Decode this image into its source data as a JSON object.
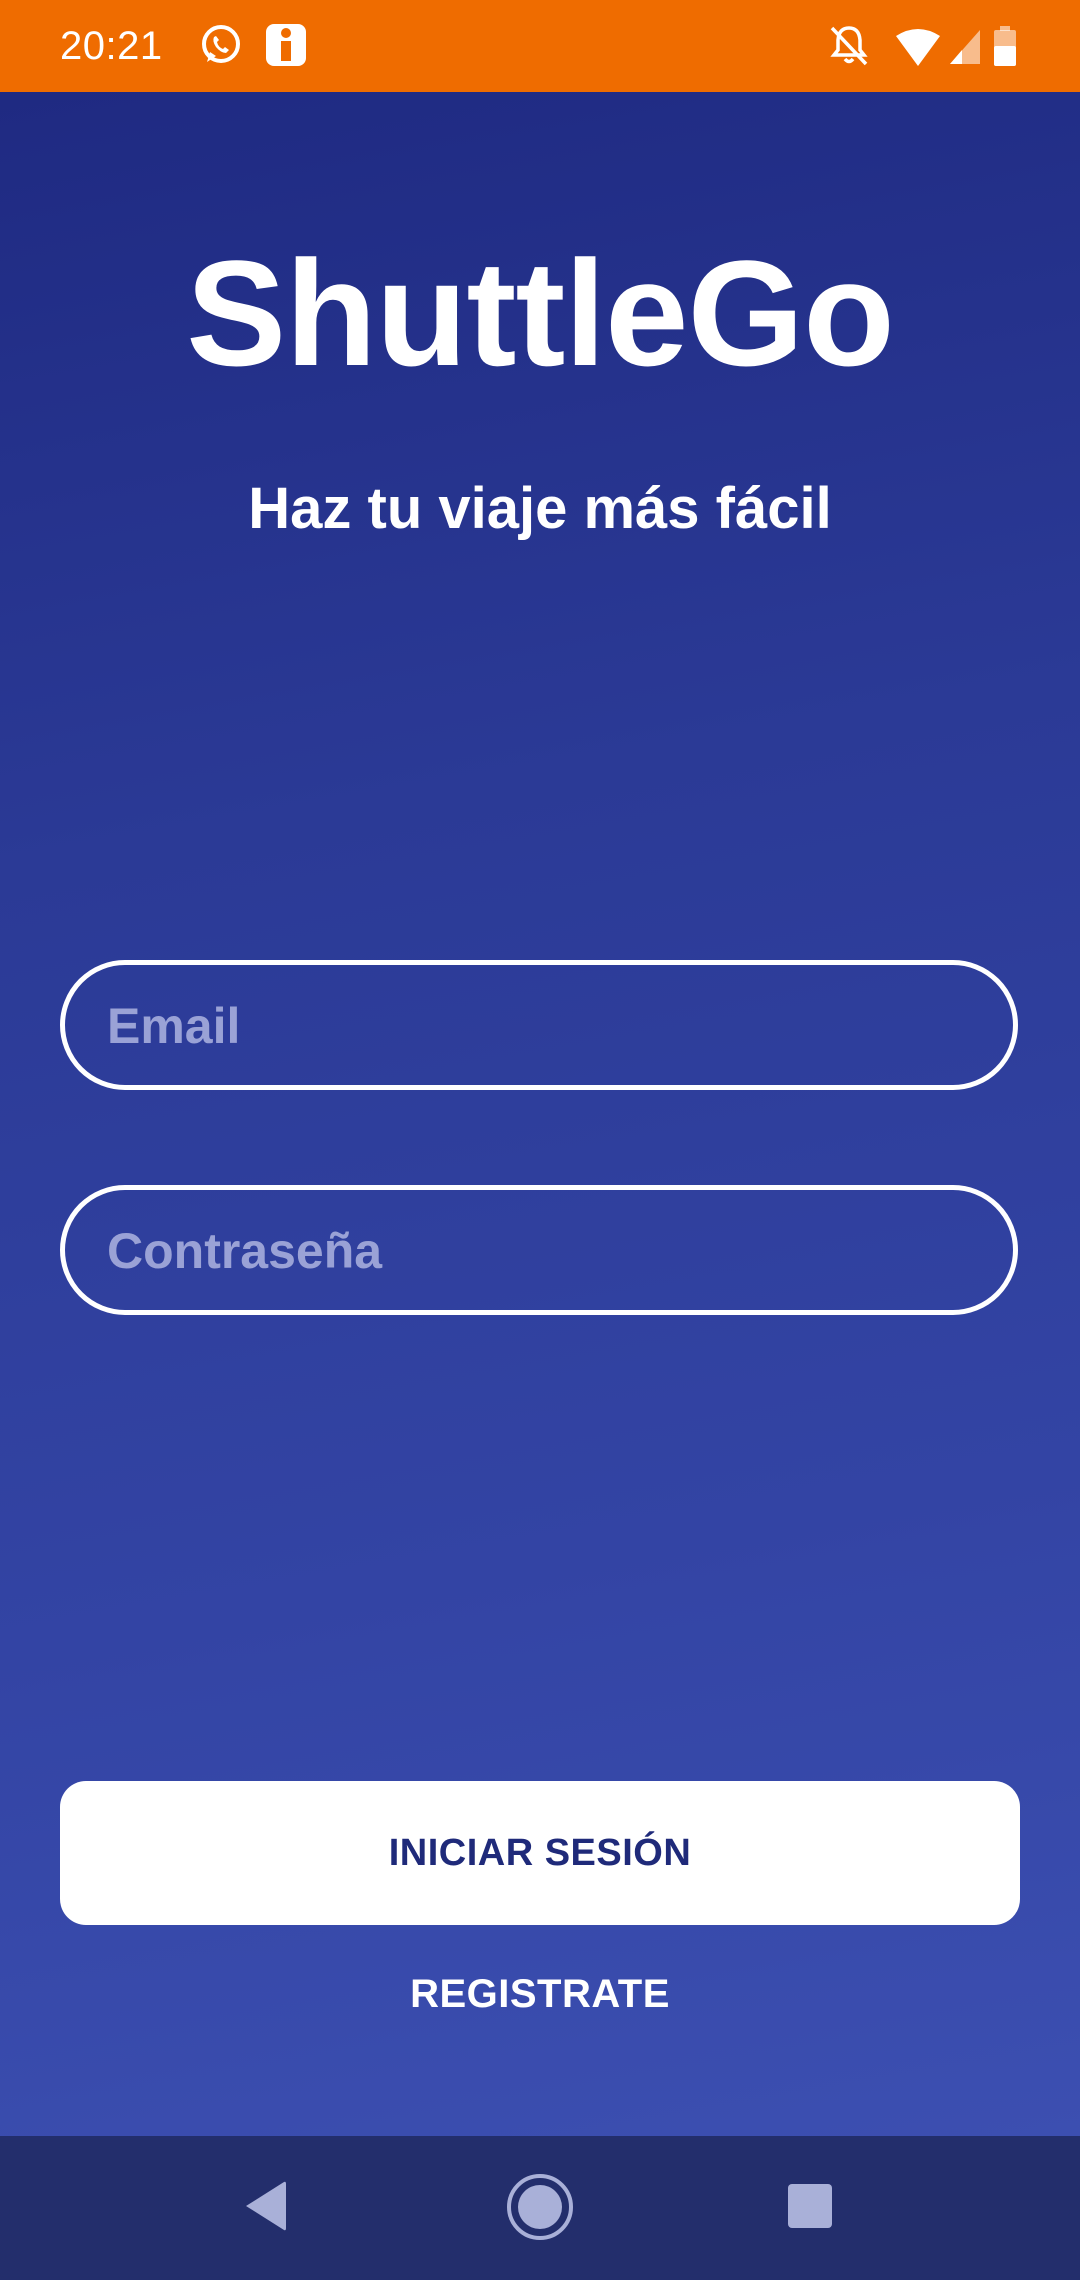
{
  "status_bar": {
    "time": "20:21",
    "icons": [
      "whatsapp-icon",
      "info-icon",
      "notifications-off-icon",
      "wifi-icon",
      "signal-icon",
      "battery-icon"
    ],
    "background_color": "#ef6c00"
  },
  "app": {
    "title": "ShuttleGo",
    "subtitle": "Haz tu viaje más fácil"
  },
  "form": {
    "email_placeholder": "Email",
    "email_value": "",
    "password_placeholder": "Contraseña",
    "password_value": "",
    "login_label": "INICIAR SESIÓN",
    "register_label": "REGISTRATE"
  },
  "nav_bar": {
    "icons": [
      "back-icon",
      "home-icon",
      "recents-icon"
    ]
  },
  "colors": {
    "gradient_start": "#1f2a82",
    "gradient_end": "#3c4fb1",
    "button_text": "#1f2a7a",
    "nav_bar": "#232e6c"
  }
}
